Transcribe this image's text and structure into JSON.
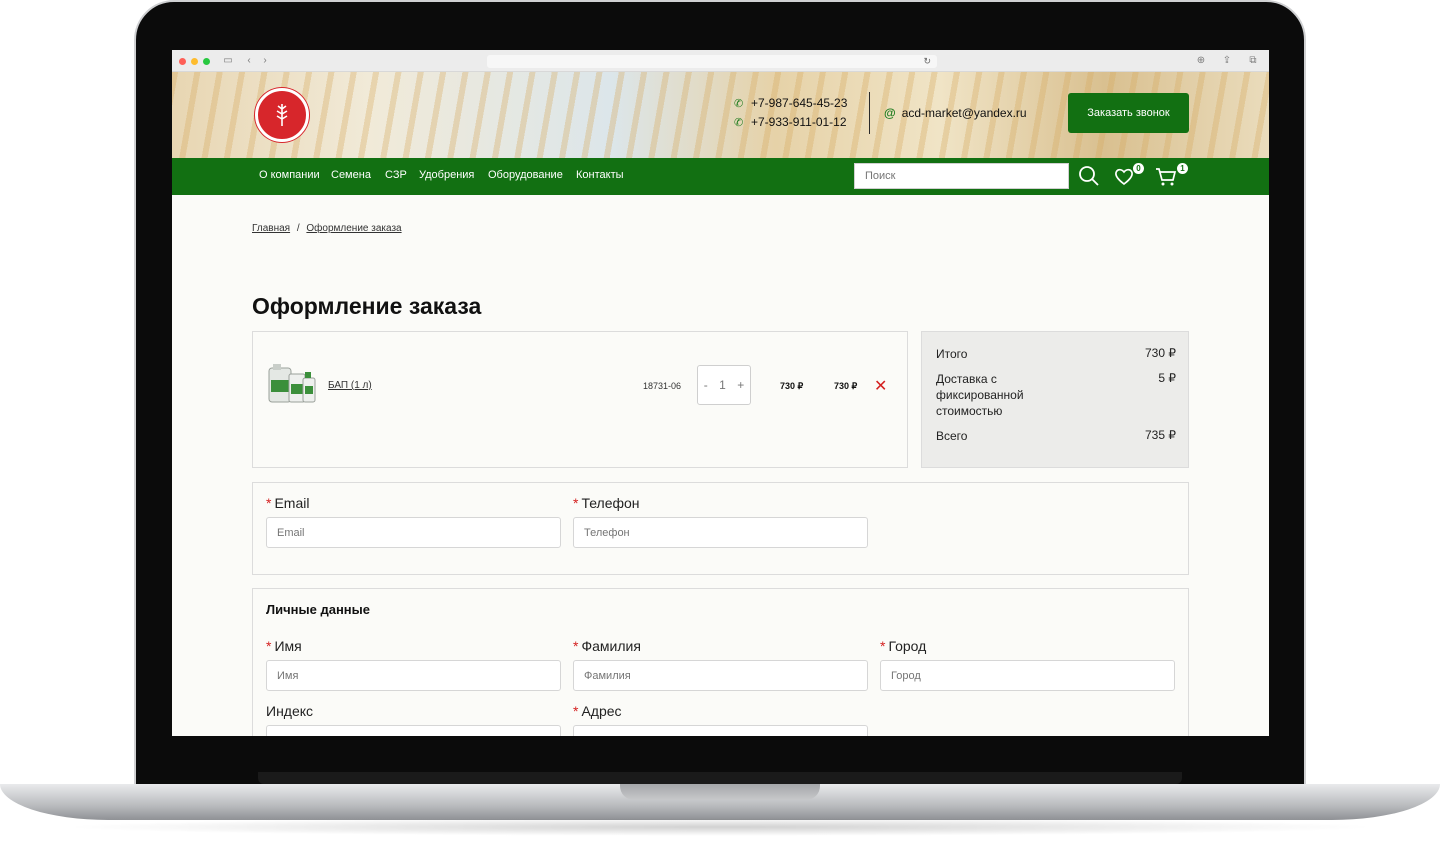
{
  "header": {
    "phone1": "+7-987-645-45-23",
    "phone2": "+7-933-911-01-12",
    "email": "acd-market@yandex.ru",
    "callback_label": "Заказать звонок"
  },
  "nav": {
    "items": [
      "О компании",
      "Семена",
      "СЗР",
      "Удобрения",
      "Оборудование",
      "Контакты"
    ],
    "search_placeholder": "Поиск",
    "favorites_count": "0",
    "cart_count": "1"
  },
  "breadcrumb": {
    "home": "Главная",
    "separator": "/",
    "current": "Оформление заказа"
  },
  "page_title": "Оформление заказа",
  "cart": {
    "item": {
      "name": "БАП (1 л)",
      "sku": "18731-06",
      "qty_minus": "-",
      "quantity": "1",
      "qty_plus": "+",
      "price": "730 ₽",
      "total": "730 ₽"
    }
  },
  "summary": {
    "subtotal_label": "Итого",
    "subtotal_value": "730 ₽",
    "delivery_label": "Доставка с фиксированной стоимостью",
    "delivery_value": "5 ₽",
    "total_label": "Всего",
    "total_value": "735 ₽"
  },
  "contact_form": {
    "required_mark": "*",
    "email_label": "Email",
    "email_placeholder": "Email",
    "phone_label": "Телефон",
    "phone_placeholder": "Телефон"
  },
  "personal_form": {
    "title": "Личные данные",
    "first_name_label": "Имя",
    "first_name_placeholder": "Имя",
    "last_name_label": "Фамилия",
    "last_name_placeholder": "Фамилия",
    "city_label": "Город",
    "city_placeholder": "Город",
    "zip_label": "Индекс",
    "address_label": "Адрес"
  },
  "colors": {
    "brand_green": "#127012",
    "accent_red": "#d42020",
    "logo_red": "#d7262b"
  }
}
